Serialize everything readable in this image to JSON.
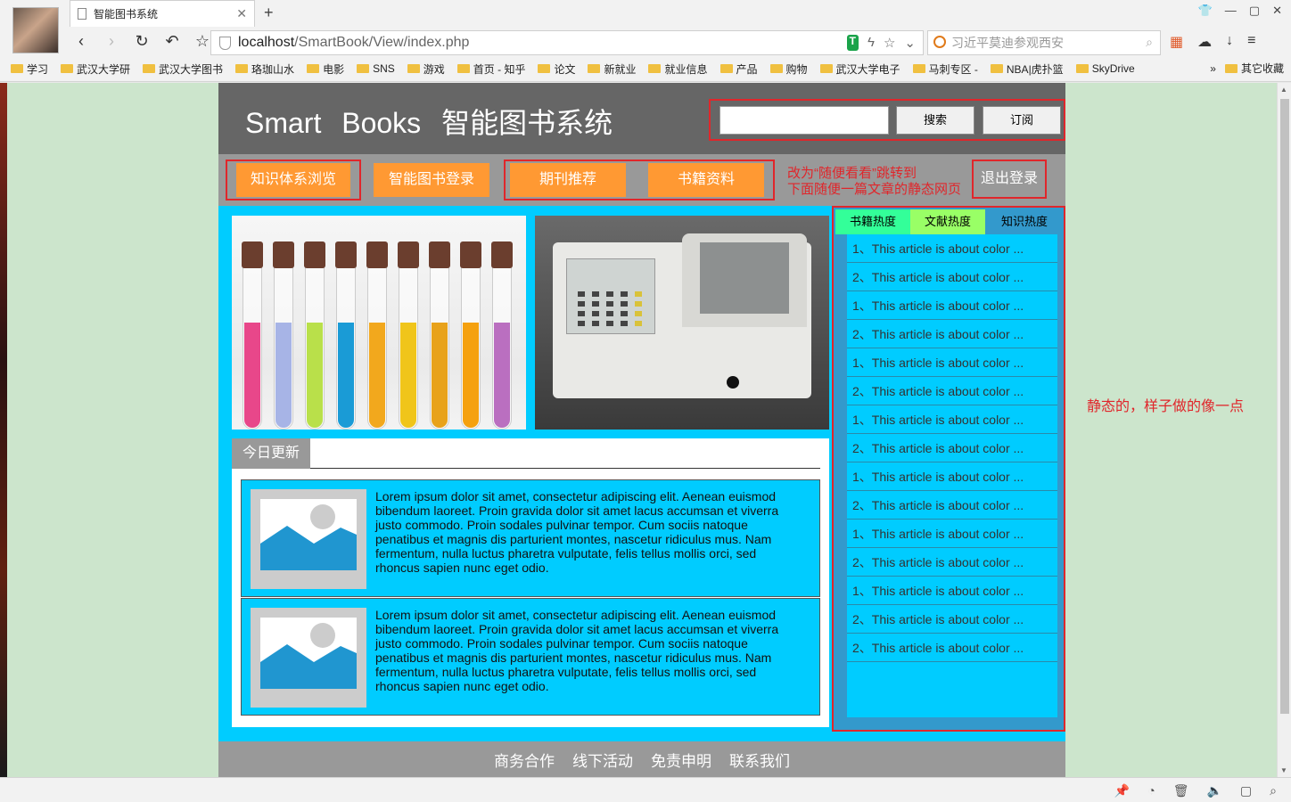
{
  "browser": {
    "tab_title": "智能图书系统",
    "url_host": "localhost",
    "url_path": "/SmartBook/View/index.php",
    "search_placeholder": "习近平莫迪参观西安",
    "bookmarks": [
      "学习",
      "武汉大学研",
      "武汉大学图书",
      "珞珈山水",
      "电影",
      "SNS",
      "游戏",
      "首页 - 知乎",
      "论文",
      "新就业",
      "就业信息",
      "产品",
      "购物",
      "武汉大学电子",
      "马刺专区 - ",
      "NBA|虎扑篮",
      "SkyDrive"
    ],
    "bookmarks_more": "»",
    "bookmarks_other": "其它收藏"
  },
  "header": {
    "logo": "Smart Books 智能图书系统",
    "search_value": "",
    "search_button": "搜索",
    "subscribe_button": "订阅"
  },
  "nav": {
    "knowledge": "知识体系浏览",
    "login": "智能图书登录",
    "journal": "期刊推荐",
    "books": "书籍资料",
    "logout": "退出登录",
    "note_line1": "改为“随便看看”跳转到",
    "note_line2": "下面随便一篇文章的静态网页"
  },
  "news": {
    "tab": "今日更新",
    "items": [
      {
        "text": "Lorem ipsum dolor sit amet, consectetur adipiscing elit. Aenean euismod bibendum laoreet. Proin gravida dolor sit amet lacus accumsan et viverra justo commodo. Proin sodales pulvinar tempor. Cum sociis natoque penatibus et magnis dis parturient montes, nascetur ridiculus mus. Nam fermentum, nulla luctus pharetra vulputate, felis tellus mollis orci, sed rhoncus sapien nunc eget odio."
      },
      {
        "text": "Lorem ipsum dolor sit amet, consectetur adipiscing elit. Aenean euismod bibendum laoreet. Proin gravida dolor sit amet lacus accumsan et viverra justo commodo. Proin sodales pulvinar tempor. Cum sociis natoque penatibus et magnis dis parturient montes, nascetur ridiculus mus. Nam fermentum, nulla luctus pharetra vulputate, felis tellus mollis orci, sed rhoncus sapien nunc eget odio."
      }
    ]
  },
  "hot": {
    "tabs": [
      "书籍热度",
      "文献热度",
      "知识热度"
    ],
    "items": [
      "1、This article is about color ...",
      "2、This article is about color ...",
      "1、This article is about color ...",
      "2、This article is about color ...",
      "1、This article is about color ...",
      "2、This article is about color ...",
      "1、This article is about color ...",
      "2、This article is about color ...",
      "1、This article is about color ...",
      "2、This article is about color ...",
      "1、This article is about color ...",
      "2、This article is about color ...",
      "1、This article is about color ...",
      "2、This article is about color ...",
      "2、This article is about color ..."
    ]
  },
  "footer": {
    "links": [
      "商务合作",
      "线下活动",
      "免责申明",
      "联系我们"
    ]
  },
  "side_note": "静态的，样子做的像一点",
  "colors": {
    "header_bg": "#666666",
    "nav_bg": "#999999",
    "accent_orange": "#ff9933",
    "content_cyan": "#00ccff",
    "annotation_red": "#e0262b",
    "page_bg": "#cce5cc"
  }
}
